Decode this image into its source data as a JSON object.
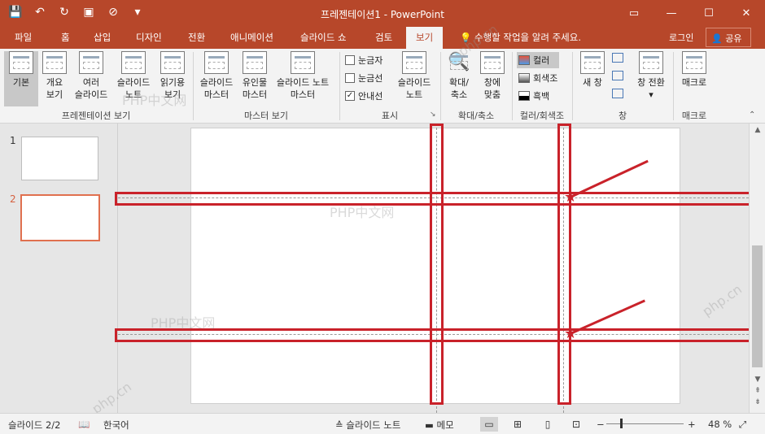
{
  "window": {
    "title": "프레젠테이션1 - PowerPoint",
    "qat_icons": [
      "save-icon",
      "undo-icon",
      "redo-icon",
      "present-icon",
      "touch-mode-icon",
      "customize-icon"
    ],
    "controls": {
      "restore": "▭",
      "minimize": "—",
      "maximize": "☐",
      "close": "✕"
    }
  },
  "tabs": [
    {
      "label": "파일"
    },
    {
      "label": "홈"
    },
    {
      "label": "삽입"
    },
    {
      "label": "디자인"
    },
    {
      "label": "전환"
    },
    {
      "label": "애니메이션"
    },
    {
      "label": "슬라이드 쇼"
    },
    {
      "label": "검토"
    },
    {
      "label": "보기"
    }
  ],
  "active_tab": "보기",
  "tell_me": "수행할 작업을 알려 주세요.",
  "login": "로그인",
  "share": "공유",
  "ribbon": {
    "presentation_views": {
      "label": "프레젠테이션 보기",
      "buttons": [
        {
          "line1": "기본",
          "line2": ""
        },
        {
          "line1": "개요",
          "line2": "보기"
        },
        {
          "line1": "여러",
          "line2": "슬라이드"
        },
        {
          "line1": "슬라이드",
          "line2": "노트"
        },
        {
          "line1": "읽기용",
          "line2": "보기"
        }
      ]
    },
    "master_views": {
      "label": "마스터 보기",
      "buttons": [
        {
          "line1": "슬라이드",
          "line2": "마스터"
        },
        {
          "line1": "유인물",
          "line2": "마스터"
        },
        {
          "line1": "슬라이드 노트",
          "line2": "마스터"
        }
      ]
    },
    "show": {
      "label": "표시",
      "checks": [
        {
          "label": "눈금자",
          "checked": false
        },
        {
          "label": "눈금선",
          "checked": false
        },
        {
          "label": "안내선",
          "checked": true
        }
      ],
      "notes_button": {
        "line1": "슬라이드",
        "line2": "노트"
      }
    },
    "zoom": {
      "label": "확대/축소",
      "buttons": [
        {
          "line1": "확대/",
          "line2": "축소"
        },
        {
          "line1": "창에",
          "line2": "맞춤"
        }
      ]
    },
    "color": {
      "label": "컬러/회색조",
      "options": [
        {
          "label": "컬러",
          "color": "#e8543a"
        },
        {
          "label": "회색조",
          "color": "#888888"
        },
        {
          "label": "흑백",
          "color": "#000000"
        }
      ]
    },
    "window": {
      "label": "창",
      "buttons": [
        {
          "line1": "새 창",
          "line2": ""
        },
        {
          "line1": "창 전환",
          "line2": "▾"
        }
      ]
    },
    "macro": {
      "label": "매크로",
      "buttons": [
        {
          "line1": "매크로",
          "line2": ""
        }
      ]
    }
  },
  "thumbnails": [
    {
      "number": "1"
    },
    {
      "number": "2"
    }
  ],
  "status": {
    "slide": "슬라이드 2/2",
    "language": "한국어",
    "notes": "슬라이드 노트",
    "comments": "메모",
    "zoom": "48 %"
  },
  "watermarks": [
    "PHP中文网",
    "PHP中文网",
    "PHP中文网",
    "php.cn",
    "php.cn",
    "php.cn"
  ]
}
